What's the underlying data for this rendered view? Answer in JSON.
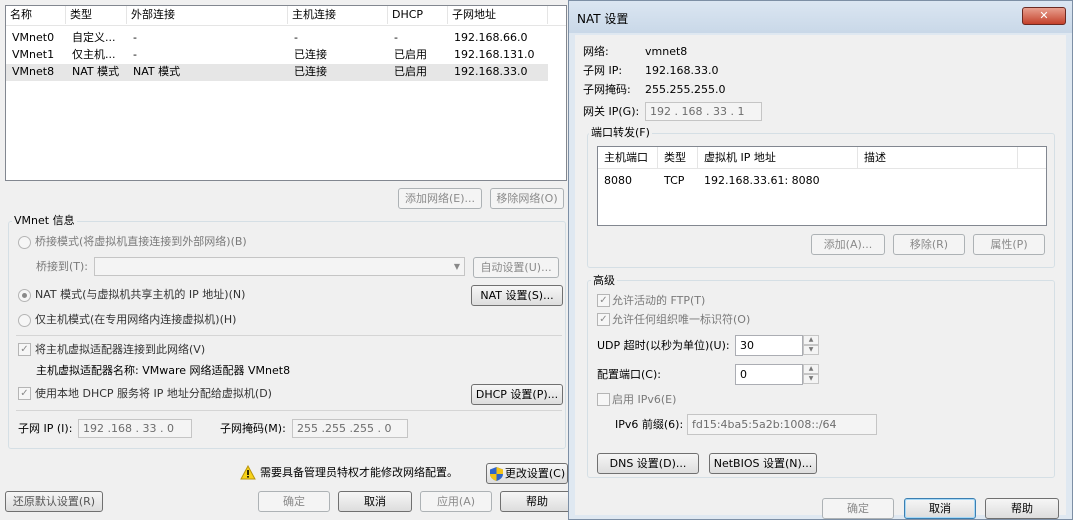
{
  "left": {
    "table": {
      "headers": [
        "名称",
        "类型",
        "外部连接",
        "主机连接",
        "DHCP",
        "子网地址"
      ],
      "rows": [
        [
          "VMnet0",
          "自定义...",
          "-",
          "-",
          "-",
          "192.168.66.0"
        ],
        [
          "VMnet1",
          "仅主机...",
          "-",
          "已连接",
          "已启用",
          "192.168.131.0"
        ],
        [
          "VMnet8",
          "NAT 模式",
          "NAT 模式",
          "已连接",
          "已启用",
          "192.168.33.0"
        ]
      ]
    },
    "add_network": "添加网络(E)...",
    "remove_network": "移除网络(O)",
    "vmnet_info": "VMnet 信息",
    "bridge_mode": "桥接模式(将虚拟机直接连接到外部网络)(B)",
    "bridge_to": "桥接到(T):",
    "auto_settings": "自动设置(U)...",
    "nat_mode": "NAT 模式(与虚拟机共享主机的 IP 地址)(N)",
    "nat_settings": "NAT 设置(S)...",
    "host_only_mode": "仅主机模式(在专用网络内连接虚拟机)(H)",
    "connect_adapter": "将主机虚拟适配器连接到此网络(V)",
    "adapter_name": "主机虚拟适配器名称: VMware 网络适配器 VMnet8",
    "use_dhcp": "使用本地 DHCP 服务将 IP 地址分配给虚拟机(D)",
    "dhcp_settings": "DHCP 设置(P)...",
    "subnet_ip_label": "子网 IP (I):",
    "subnet_ip": "192 .168 . 33  .  0",
    "subnet_mask_label": "子网掩码(M):",
    "subnet_mask": "255 .255 .255 .  0",
    "admin_warning": "需要具备管理员特权才能修改网络配置。",
    "change_settings": "更改设置(C)",
    "restore_defaults": "还原默认设置(R)",
    "ok": "确定",
    "cancel": "取消",
    "apply": "应用(A)",
    "help": "帮助"
  },
  "nat": {
    "title": "NAT 设置",
    "close": "✕",
    "network_label": "网络:",
    "network_value": "vmnet8",
    "subnet_ip_label": "子网 IP:",
    "subnet_ip_value": "192.168.33.0",
    "subnet_mask_label": "子网掩码:",
    "subnet_mask_value": "255.255.255.0",
    "gateway_label": "网关 IP(G):",
    "gateway_value": "192 . 168 . 33  .  1",
    "port_forwarding": "端口转发(F)",
    "pf_headers": [
      "主机端口",
      "类型",
      "虚拟机 IP 地址",
      "描述"
    ],
    "pf_rows": [
      [
        "8080",
        "TCP",
        "192.168.33.61: 8080",
        ""
      ]
    ],
    "add": "添加(A)...",
    "remove": "移除(R)",
    "properties": "属性(P)",
    "advanced": "高级",
    "allow_ftp": "允许活动的 FTP(T)",
    "allow_oui": "允许任何组织唯一标识符(O)",
    "udp_timeout_label": "UDP 超时(以秒为单位)(U):",
    "udp_timeout": "30",
    "config_port_label": "配置端口(C):",
    "config_port": "0",
    "enable_ipv6": "启用 IPv6(E)",
    "ipv6_prefix_label": "IPv6 前缀(6):",
    "ipv6_prefix": "fd15:4ba5:5a2b:1008::/64",
    "dns_settings": "DNS 设置(D)...",
    "netbios_settings": "NetBIOS 设置(N)...",
    "ok": "确定",
    "cancel": "取消",
    "help": "帮助"
  }
}
